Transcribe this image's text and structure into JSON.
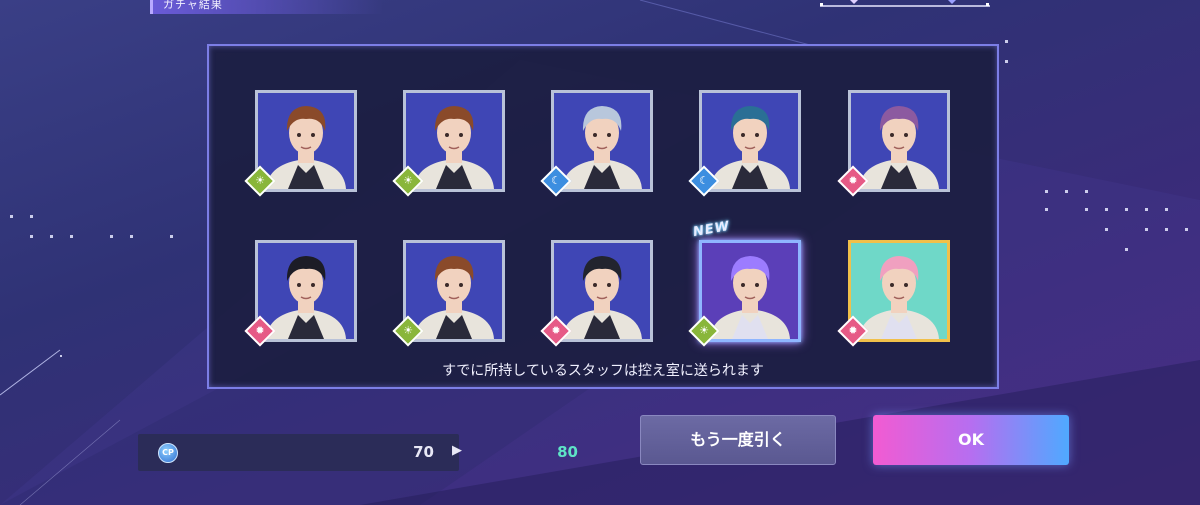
{
  "header": {
    "title": "ガチャ結果"
  },
  "cards": [
    {
      "element": "sun",
      "glyph": "☀",
      "badge_color": "green",
      "is_new": false,
      "hair": "#8a4a2a",
      "frame": "silver"
    },
    {
      "element": "sun",
      "glyph": "☀",
      "badge_color": "green",
      "is_new": false,
      "hair": "#8a4a2a",
      "frame": "silver"
    },
    {
      "element": "moon",
      "glyph": "☾",
      "badge_color": "blue",
      "is_new": false,
      "hair": "#b8c7dc",
      "frame": "silver"
    },
    {
      "element": "moon",
      "glyph": "☾",
      "badge_color": "blue",
      "is_new": false,
      "hair": "#2a6f95",
      "frame": "silver"
    },
    {
      "element": "star",
      "glyph": "✹",
      "badge_color": "pink",
      "is_new": false,
      "hair": "#8c5aa0",
      "frame": "silver"
    },
    {
      "element": "star",
      "glyph": "✹",
      "badge_color": "pink",
      "is_new": false,
      "hair": "#1c1c26",
      "frame": "silver"
    },
    {
      "element": "sun",
      "glyph": "☀",
      "badge_color": "green",
      "is_new": false,
      "hair": "#8a4a2a",
      "frame": "silver"
    },
    {
      "element": "star",
      "glyph": "✹",
      "badge_color": "pink",
      "is_new": false,
      "hair": "#22242e",
      "frame": "silver"
    },
    {
      "element": "sun",
      "glyph": "☀",
      "badge_color": "green",
      "is_new": true,
      "hair": "#9c7cff",
      "frame": "rainbow"
    },
    {
      "element": "star",
      "glyph": "✹",
      "badge_color": "pink",
      "is_new": false,
      "hair": "#f0a0c0",
      "frame": "gold"
    }
  ],
  "new_label": "NEW",
  "notice": "すでに所持しているスタッフは控え室に送られます",
  "cp": {
    "icon_label": "CP",
    "from": "70",
    "arrow": "▶",
    "to": "80"
  },
  "buttons": {
    "again": "もう一度引く",
    "ok": "OK"
  }
}
